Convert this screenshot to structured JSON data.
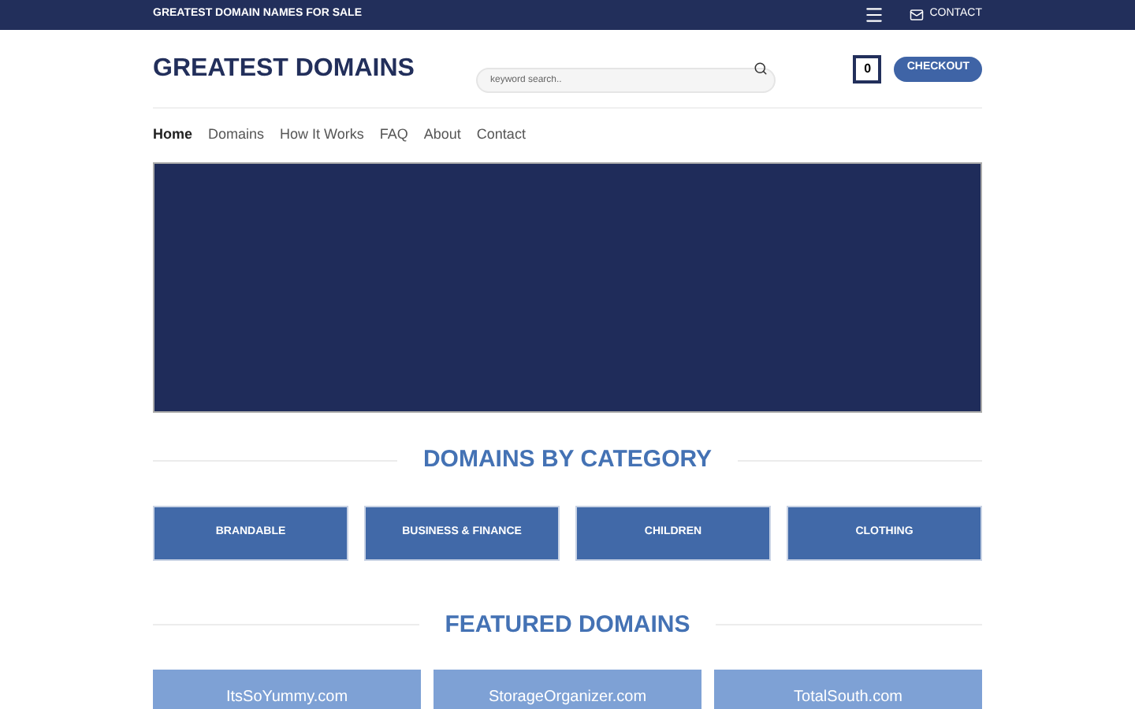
{
  "top_bar": {
    "tagline": "GREATEST DOMAIN NAMES FOR SALE",
    "contact": "CONTACT"
  },
  "header": {
    "logo": "GREATEST DOMAINS",
    "search": {
      "placeholder": "keyword search.."
    },
    "cart_count": "0",
    "checkout": "CHECKOUT"
  },
  "nav": [
    {
      "label": "Home",
      "selected": true
    },
    {
      "label": "Domains",
      "selected": false
    },
    {
      "label": "How It Works",
      "selected": false
    },
    {
      "label": "FAQ",
      "selected": false
    },
    {
      "label": "About",
      "selected": false
    },
    {
      "label": "Contact",
      "selected": false
    }
  ],
  "categories": {
    "title": "DOMAINS BY CATEGORY",
    "items": [
      "BRANDABLE",
      "BUSINESS & FINANCE",
      "CHILDREN",
      "CLOTHING"
    ]
  },
  "featured": {
    "title": "FEATURED DOMAINS",
    "items": [
      "ItsSoYummy.com",
      "StorageOrganizer.com",
      "TotalSouth.com"
    ]
  }
}
